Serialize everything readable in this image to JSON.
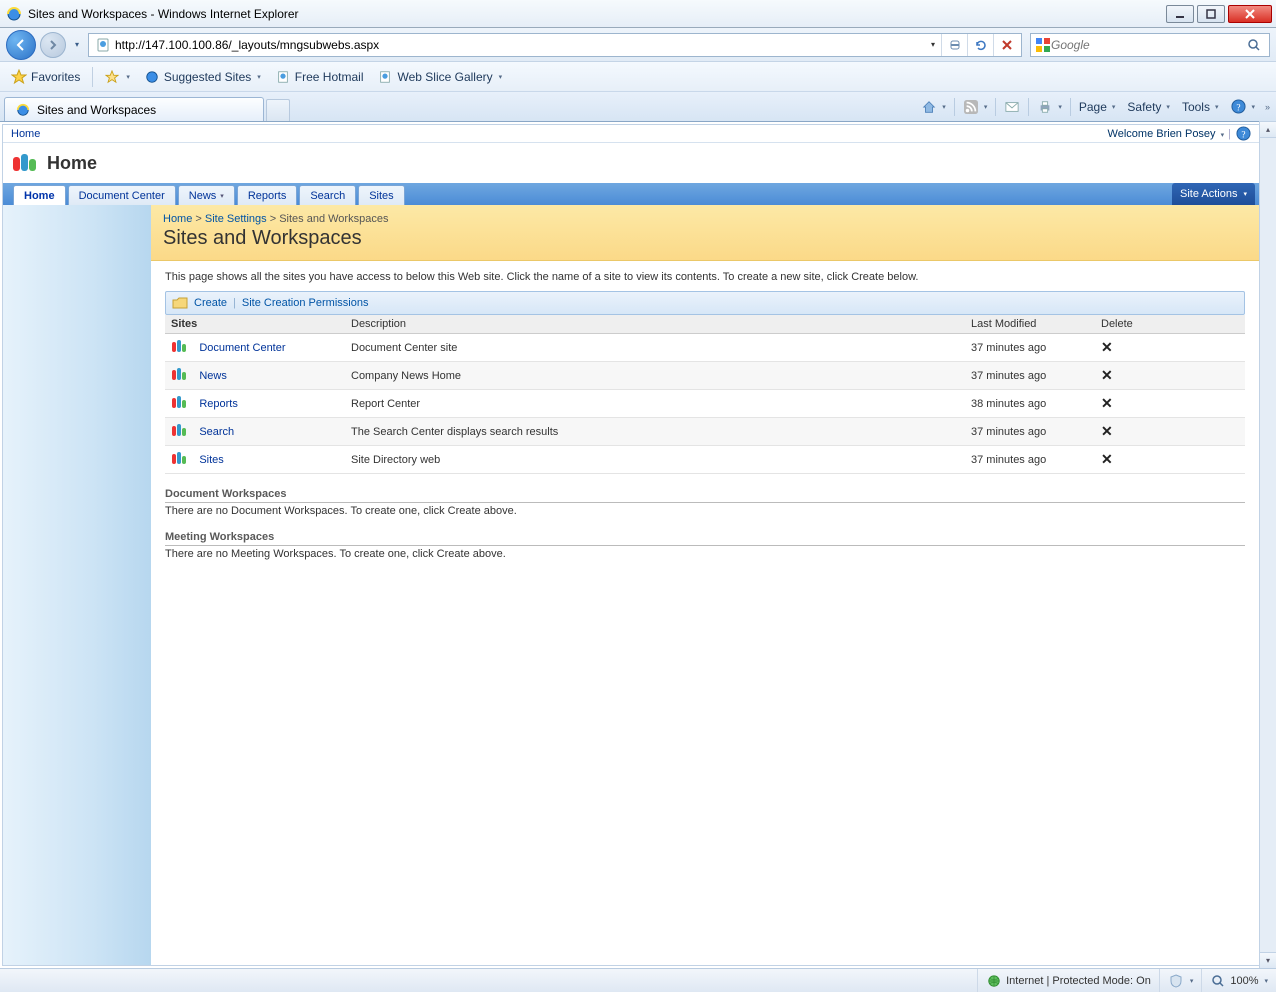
{
  "window": {
    "title": "Sites and Workspaces - Windows Internet Explorer"
  },
  "address": {
    "url": "http://147.100.100.86/_layouts/mngsubwebs.aspx"
  },
  "search": {
    "placeholder": "Google"
  },
  "favbar": {
    "favorites": "Favorites",
    "suggested": "Suggested Sites",
    "hotmail": "Free Hotmail",
    "webslice": "Web Slice Gallery"
  },
  "ietab": {
    "label": "Sites and Workspaces"
  },
  "cmdbar": {
    "page": "Page",
    "safety": "Safety",
    "tools": "Tools"
  },
  "sharepoint": {
    "top": {
      "home": "Home",
      "welcome": "Welcome Brien Posey"
    },
    "site_title": "Home",
    "tabs": [
      "Home",
      "Document Center",
      "News",
      "Reports",
      "Search",
      "Sites"
    ],
    "site_actions": "Site Actions",
    "breadcrumb": {
      "home": "Home",
      "settings": "Site Settings",
      "current": "Sites and Workspaces"
    },
    "page_title": "Sites and Workspaces",
    "description": "This page shows all the sites you have access to below this Web site. Click the name of a site to view its contents. To create a new site, click Create below.",
    "toolbar": {
      "create": "Create",
      "perms": "Site Creation Permissions"
    },
    "cols": {
      "sites": "Sites",
      "desc": "Description",
      "modified": "Last Modified",
      "delete": "Delete"
    },
    "rows": [
      {
        "name": "Document Center",
        "desc": "Document Center site",
        "modified": "37 minutes ago"
      },
      {
        "name": "News",
        "desc": "Company News Home",
        "modified": "37 minutes ago"
      },
      {
        "name": "Reports",
        "desc": "Report Center",
        "modified": "38 minutes ago"
      },
      {
        "name": "Search",
        "desc": "The Search Center displays search results",
        "modified": "37 minutes ago"
      },
      {
        "name": "Sites",
        "desc": "Site Directory web",
        "modified": "37 minutes ago"
      }
    ],
    "docws": {
      "heading": "Document Workspaces",
      "msg": "There are no Document Workspaces. To create one, click Create above."
    },
    "meetws": {
      "heading": "Meeting Workspaces",
      "msg": "There are no Meeting Workspaces. To create one, click Create above."
    }
  },
  "statusbar": {
    "zone": "Internet | Protected Mode: On",
    "zoom": "100%"
  }
}
